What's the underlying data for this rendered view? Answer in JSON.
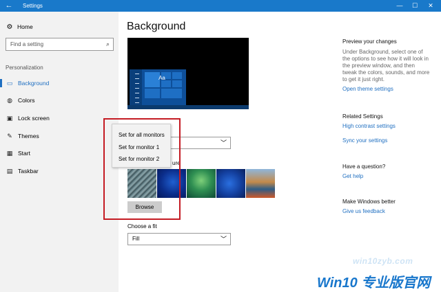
{
  "window": {
    "title": "Settings",
    "back_glyph": "←",
    "minimize_glyph": "—",
    "maximize_glyph": "☐",
    "close_glyph": "✕"
  },
  "sidebar": {
    "home_label": "Home",
    "search_placeholder": "Find a setting",
    "section_label": "Personalization",
    "items": [
      {
        "label": "Background",
        "icon": "picture-icon",
        "active": true
      },
      {
        "label": "Colors",
        "icon": "palette-icon",
        "active": false
      },
      {
        "label": "Lock screen",
        "icon": "lock-screen-icon",
        "active": false
      },
      {
        "label": "Themes",
        "icon": "brush-icon",
        "active": false
      },
      {
        "label": "Start",
        "icon": "start-grid-icon",
        "active": false
      },
      {
        "label": "Taskbar",
        "icon": "taskbar-icon",
        "active": false
      }
    ]
  },
  "main": {
    "title": "Background",
    "preview_tile_text": "Aa",
    "choose_picture_partial_label": "ure",
    "browse_label": "Browse",
    "fit_label": "Choose a fit",
    "fit_value": "Fill"
  },
  "popup_menu": {
    "items": [
      "Set for all monitors",
      "Set for monitor 1",
      "Set for monitor 2"
    ]
  },
  "right_panel": {
    "preview_heading": "Preview your changes",
    "preview_desc": [
      "Under Background, select one of",
      "the options to see how it will look in",
      "the preview window, and then",
      "tweak the colors, sounds, and more",
      "to get it just right."
    ],
    "open_theme_link": "Open theme settings",
    "related_heading": "Related Settings",
    "high_contrast_link": "High contrast settings",
    "sync_link": "Sync your settings",
    "question_heading": "Have a question?",
    "get_help_link": "Get help",
    "better_heading": "Make Windows better",
    "feedback_link": "Give us feedback"
  },
  "watermark": {
    "line1": "win10zyb.com",
    "line2": "Win10 专业版官网"
  },
  "colors": {
    "accent": "#1979ca",
    "highlight_border": "#c41a22",
    "link": "#1f6fc1"
  }
}
